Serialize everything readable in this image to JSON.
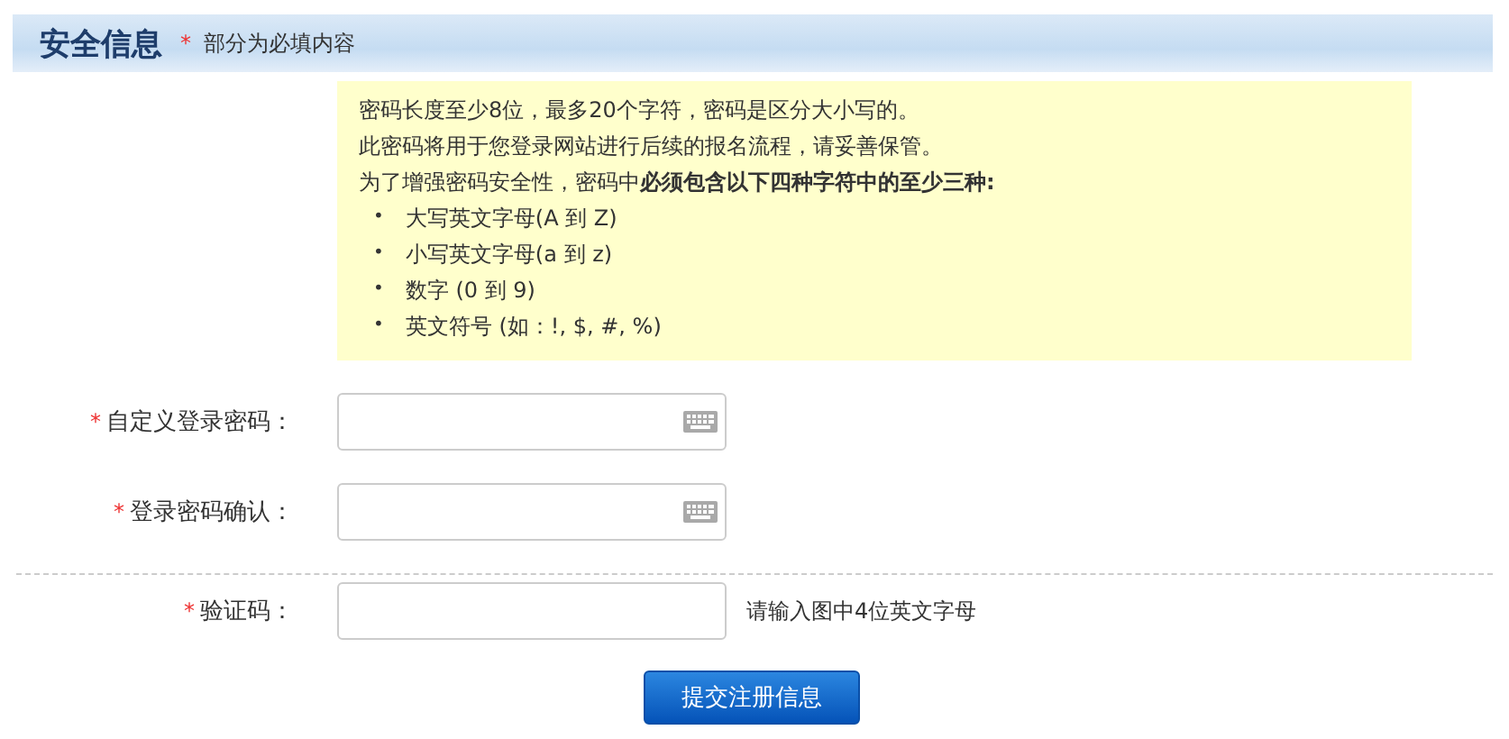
{
  "section": {
    "title": "安全信息",
    "required_note": "部分为必填内容",
    "required_mark": "*"
  },
  "notice": {
    "lines": [
      "密码长度至少8位，最多20个字符，密码是区分大小写的。",
      "此密码将用于您登录网站进行后续的报名流程，请妥善保管。",
      "为了增强密码安全性，密码中**必须包含以下四种字符中的至少三种:**"
    ],
    "marker": "•",
    "bullets": [
      "大写英文字母(A 到 Z)",
      "小写英文字母(a 到 z)",
      "数字 (0 到 9)",
      "英文符号 (如：!, $, #, %)"
    ]
  },
  "fields": [
    {
      "kind": "password",
      "label": "自定义登录密码：",
      "required": true
    },
    {
      "kind": "password",
      "label": "登录密码确认：",
      "required": true
    },
    {
      "kind": "captcha",
      "label": "验证码：",
      "required": true,
      "hint": "请输入图中4位英文字母"
    }
  ],
  "submit": "提交注册信息"
}
